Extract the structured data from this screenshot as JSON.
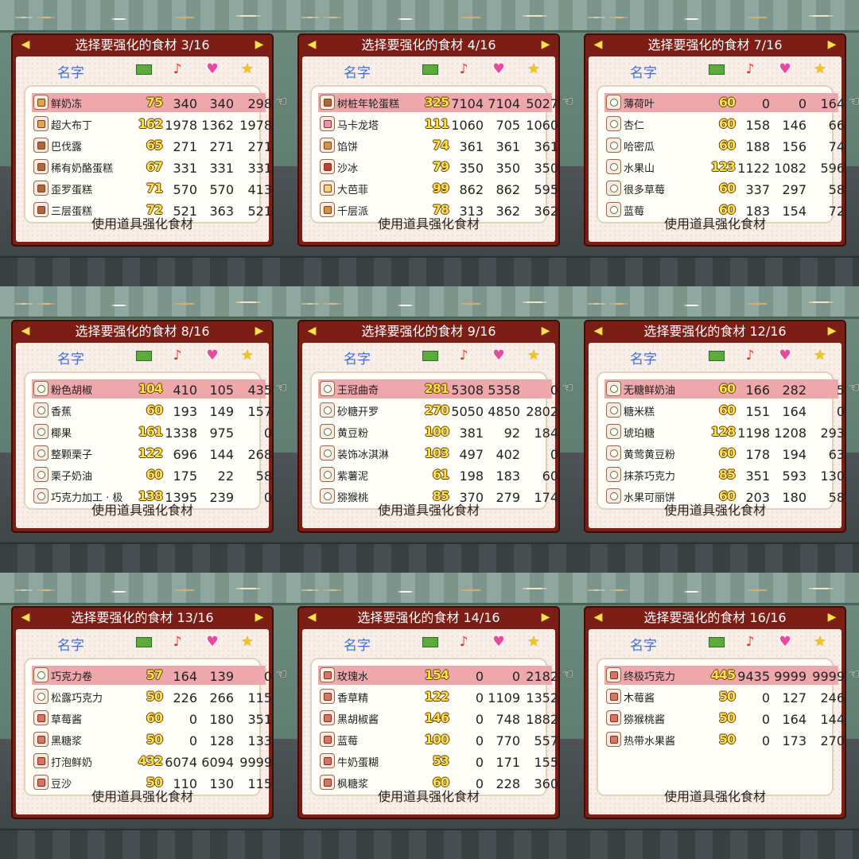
{
  "footer_label": "使用道具强化食材",
  "header_name_label": "名字",
  "header_icons": [
    "money-icon",
    "music-note-icon",
    "heart-icon",
    "star-icon"
  ],
  "colors": {
    "panel_frame": "#7a1e16",
    "panel_bg": "#f7efe8",
    "selected_row": "#eea7ab",
    "header_name": "#3c6fd6",
    "level_digits": "#ffe24b"
  },
  "panels": [
    {
      "title": "选择要强化的食材 3/16",
      "rows": [
        {
          "name": "鲜奶冻",
          "level": "75",
          "v1": "340",
          "v2": "340",
          "v3": "298",
          "icon": "pudding-icon",
          "selected": true
        },
        {
          "name": "超大布丁",
          "level": "162",
          "v1": "1978",
          "v2": "1362",
          "v3": "1978",
          "icon": "pudding-icon",
          "selected": false
        },
        {
          "name": "巴伐露",
          "level": "65",
          "v1": "271",
          "v2": "271",
          "v3": "271",
          "icon": "cake-icon",
          "selected": false
        },
        {
          "name": "稀有奶酪蛋糕",
          "level": "67",
          "v1": "331",
          "v2": "331",
          "v3": "331",
          "icon": "cake-icon",
          "selected": false
        },
        {
          "name": "歪罗蛋糕",
          "level": "71",
          "v1": "570",
          "v2": "570",
          "v3": "413",
          "icon": "cake-icon",
          "selected": false
        },
        {
          "name": "三层蛋糕",
          "level": "72",
          "v1": "521",
          "v2": "363",
          "v3": "521",
          "icon": "cake-icon",
          "selected": false
        }
      ]
    },
    {
      "title": "选择要强化的食材 4/16",
      "rows": [
        {
          "name": "树桩年轮蛋糕",
          "level": "325",
          "v1": "7104",
          "v2": "7104",
          "v3": "5027",
          "icon": "cake-icon",
          "selected": true
        },
        {
          "name": "马卡龙塔",
          "level": "111",
          "v1": "1060",
          "v2": "705",
          "v3": "1060",
          "icon": "macaron-icon",
          "selected": false
        },
        {
          "name": "馅饼",
          "level": "74",
          "v1": "361",
          "v2": "361",
          "v3": "361",
          "icon": "pie-icon",
          "selected": false
        },
        {
          "name": "沙冰",
          "level": "79",
          "v1": "350",
          "v2": "350",
          "v3": "350",
          "icon": "sherbet-icon",
          "selected": false
        },
        {
          "name": "大芭菲",
          "level": "99",
          "v1": "862",
          "v2": "862",
          "v3": "595",
          "icon": "parfait-icon",
          "selected": false
        },
        {
          "name": "千层派",
          "level": "78",
          "v1": "313",
          "v2": "362",
          "v3": "362",
          "icon": "pie-icon",
          "selected": false
        }
      ]
    },
    {
      "title": "选择要强化的食材 7/16",
      "rows": [
        {
          "name": "薄荷叶",
          "level": "60",
          "v1": "0",
          "v2": "0",
          "v3": "164",
          "icon": "herb-icon",
          "selected": true
        },
        {
          "name": "杏仁",
          "level": "60",
          "v1": "158",
          "v2": "146",
          "v3": "66",
          "icon": "herb-icon",
          "selected": false
        },
        {
          "name": "哈密瓜",
          "level": "60",
          "v1": "188",
          "v2": "156",
          "v3": "74",
          "icon": "herb-icon",
          "selected": false
        },
        {
          "name": "水果山",
          "level": "123",
          "v1": "1122",
          "v2": "1082",
          "v3": "596",
          "icon": "herb-icon",
          "selected": false
        },
        {
          "name": "很多草莓",
          "level": "60",
          "v1": "337",
          "v2": "297",
          "v3": "58",
          "icon": "herb-icon",
          "selected": false
        },
        {
          "name": "蓝莓",
          "level": "60",
          "v1": "183",
          "v2": "154",
          "v3": "72",
          "icon": "herb-icon",
          "selected": false
        }
      ]
    },
    {
      "title": "选择要强化的食材 8/16",
      "rows": [
        {
          "name": "粉色胡椒",
          "level": "104",
          "v1": "410",
          "v2": "105",
          "v3": "435",
          "icon": "herb-icon",
          "selected": true
        },
        {
          "name": "香蕉",
          "level": "60",
          "v1": "193",
          "v2": "149",
          "v3": "157",
          "icon": "herb-icon",
          "selected": false
        },
        {
          "name": "椰果",
          "level": "161",
          "v1": "1338",
          "v2": "975",
          "v3": "0",
          "icon": "herb-icon",
          "selected": false
        },
        {
          "name": "整颗栗子",
          "level": "122",
          "v1": "696",
          "v2": "144",
          "v3": "268",
          "icon": "herb-icon",
          "selected": false
        },
        {
          "name": "栗子奶油",
          "level": "60",
          "v1": "175",
          "v2": "22",
          "v3": "58",
          "icon": "herb-icon",
          "selected": false
        },
        {
          "name": "巧克力加工 · 极",
          "level": "138",
          "v1": "1395",
          "v2": "239",
          "v3": "0",
          "icon": "herb-icon",
          "selected": false
        }
      ]
    },
    {
      "title": "选择要强化的食材 9/16",
      "rows": [
        {
          "name": "王冠曲奇",
          "level": "281",
          "v1": "5308",
          "v2": "5358",
          "v3": "0",
          "icon": "herb-icon",
          "selected": true
        },
        {
          "name": "砂糖开罗",
          "level": "270",
          "v1": "5050",
          "v2": "4850",
          "v3": "2802",
          "icon": "herb-icon",
          "selected": false
        },
        {
          "name": "黄豆粉",
          "level": "100",
          "v1": "381",
          "v2": "92",
          "v3": "184",
          "icon": "herb-icon",
          "selected": false
        },
        {
          "name": "装饰冰淇淋",
          "level": "103",
          "v1": "497",
          "v2": "402",
          "v3": "0",
          "icon": "herb-icon",
          "selected": false
        },
        {
          "name": "紫薯泥",
          "level": "61",
          "v1": "198",
          "v2": "183",
          "v3": "60",
          "icon": "herb-icon",
          "selected": false
        },
        {
          "name": "猕猴桃",
          "level": "85",
          "v1": "370",
          "v2": "279",
          "v3": "174",
          "icon": "herb-icon",
          "selected": false
        }
      ]
    },
    {
      "title": "选择要强化的食材 12/16",
      "rows": [
        {
          "name": "无糖鲜奶油",
          "level": "60",
          "v1": "166",
          "v2": "282",
          "v3": "5",
          "icon": "herb-icon",
          "selected": true
        },
        {
          "name": "糖米糕",
          "level": "60",
          "v1": "151",
          "v2": "164",
          "v3": "0",
          "icon": "herb-icon",
          "selected": false
        },
        {
          "name": "琥珀糖",
          "level": "128",
          "v1": "1198",
          "v2": "1208",
          "v3": "293",
          "icon": "herb-icon",
          "selected": false
        },
        {
          "name": "黄莺黄豆粉",
          "level": "60",
          "v1": "178",
          "v2": "194",
          "v3": "63",
          "icon": "herb-icon",
          "selected": false
        },
        {
          "name": "抹茶巧克力",
          "level": "85",
          "v1": "351",
          "v2": "593",
          "v3": "130",
          "icon": "herb-icon",
          "selected": false
        },
        {
          "name": "水果可丽饼",
          "level": "60",
          "v1": "203",
          "v2": "180",
          "v3": "58",
          "icon": "herb-icon",
          "selected": false
        }
      ]
    },
    {
      "title": "选择要强化的食材 13/16",
      "rows": [
        {
          "name": "巧克力卷",
          "level": "57",
          "v1": "164",
          "v2": "139",
          "v3": "0",
          "icon": "herb-icon",
          "selected": true
        },
        {
          "name": "松露巧克力",
          "level": "50",
          "v1": "226",
          "v2": "266",
          "v3": "115",
          "icon": "herb-icon",
          "selected": false
        },
        {
          "name": "草莓酱",
          "level": "60",
          "v1": "0",
          "v2": "180",
          "v3": "351",
          "icon": "jar-icon",
          "selected": false
        },
        {
          "name": "黑糖浆",
          "level": "50",
          "v1": "0",
          "v2": "128",
          "v3": "133",
          "icon": "jar-icon",
          "selected": false
        },
        {
          "name": "打泡鲜奶",
          "level": "432",
          "v1": "6074",
          "v2": "6094",
          "v3": "9999",
          "icon": "jar-icon",
          "selected": false
        },
        {
          "name": "豆沙",
          "level": "50",
          "v1": "110",
          "v2": "130",
          "v3": "115",
          "icon": "jar-icon",
          "selected": false
        }
      ]
    },
    {
      "title": "选择要强化的食材 14/16",
      "rows": [
        {
          "name": "玫瑰水",
          "level": "154",
          "v1": "0",
          "v2": "0",
          "v3": "2182",
          "icon": "jar-icon",
          "selected": true
        },
        {
          "name": "香草精",
          "level": "122",
          "v1": "0",
          "v2": "1109",
          "v3": "1352",
          "icon": "jar-icon",
          "selected": false
        },
        {
          "name": "黑胡椒酱",
          "level": "146",
          "v1": "0",
          "v2": "748",
          "v3": "1882",
          "icon": "jar-icon",
          "selected": false
        },
        {
          "name": "蓝莓",
          "level": "100",
          "v1": "0",
          "v2": "770",
          "v3": "557",
          "icon": "jar-icon",
          "selected": false
        },
        {
          "name": "牛奶蛋糊",
          "level": "53",
          "v1": "0",
          "v2": "171",
          "v3": "155",
          "icon": "jar-icon",
          "selected": false
        },
        {
          "name": "枫糖浆",
          "level": "60",
          "v1": "0",
          "v2": "228",
          "v3": "360",
          "icon": "jar-icon",
          "selected": false
        }
      ]
    },
    {
      "title": "选择要强化的食材 16/16",
      "rows": [
        {
          "name": "终极巧克力",
          "level": "445",
          "v1": "9435",
          "v2": "9999",
          "v3": "9999",
          "icon": "jar-icon",
          "selected": true
        },
        {
          "name": "木莓酱",
          "level": "50",
          "v1": "0",
          "v2": "127",
          "v3": "246",
          "icon": "jar-icon",
          "selected": false
        },
        {
          "name": "猕猴桃酱",
          "level": "50",
          "v1": "0",
          "v2": "164",
          "v3": "144",
          "icon": "jar-icon",
          "selected": false
        },
        {
          "name": "热带水果酱",
          "level": "50",
          "v1": "0",
          "v2": "173",
          "v3": "270",
          "icon": "jar-icon",
          "selected": false
        }
      ]
    }
  ]
}
